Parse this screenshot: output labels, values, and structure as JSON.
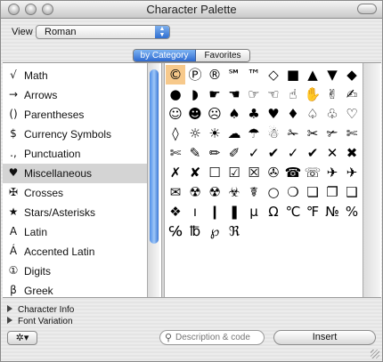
{
  "window": {
    "title": "Character Palette"
  },
  "view": {
    "label": "View :",
    "selected": "Roman"
  },
  "tabs": [
    {
      "label": "by Category",
      "selected": true
    },
    {
      "label": "Favorites",
      "selected": false
    }
  ],
  "categories": [
    {
      "icon": "√",
      "label": "Math"
    },
    {
      "icon": "→",
      "label": "Arrows"
    },
    {
      "icon": "()",
      "label": "Parentheses"
    },
    {
      "icon": "$",
      "label": "Currency Symbols"
    },
    {
      "icon": ".,",
      "label": "Punctuation"
    },
    {
      "icon": "♥",
      "label": "Miscellaneous",
      "selected": true
    },
    {
      "icon": "✠",
      "label": "Crosses"
    },
    {
      "icon": "★",
      "label": "Stars/Asterisks"
    },
    {
      "icon": "A",
      "label": "Latin"
    },
    {
      "icon": "Á",
      "label": "Accented Latin"
    },
    {
      "icon": "①",
      "label": "Digits"
    },
    {
      "icon": "β",
      "label": "Greek"
    }
  ],
  "characters": [
    [
      "©",
      "Ⓟ",
      "®",
      "℠",
      "™",
      "◇",
      "■",
      "▲",
      "▼",
      "◆"
    ],
    [
      "●",
      "◗",
      "☛",
      "☚",
      "☞",
      "☜",
      "☝",
      "✋",
      "✌",
      "✍"
    ],
    [
      "☺",
      "☻",
      "☹",
      "♠",
      "♣",
      "♥",
      "♦",
      "♤",
      "♧",
      "♡"
    ],
    [
      "◊",
      "☼",
      "☀",
      "☁",
      "☂",
      "☃",
      "✁",
      "✂",
      "✃",
      "✄"
    ],
    [
      "✄",
      "✎",
      "✏",
      "✐",
      "✓",
      "✔",
      "✓",
      "✔",
      "✕",
      "✖"
    ],
    [
      "✗",
      "✘",
      "☐",
      "☑",
      "☒",
      "✇",
      "☎",
      "☏",
      "✈",
      "✈"
    ],
    [
      "✉",
      "☢",
      "☢",
      "☣",
      "☤",
      "○",
      "❍",
      "❏",
      "❐",
      "❑"
    ],
    [
      "❖",
      "ı",
      "❙",
      "❚",
      "μ",
      "Ω",
      "℃",
      "℉",
      "№",
      "%"
    ],
    [
      "℅",
      "℔",
      "℘",
      "ℜ"
    ]
  ],
  "footer": {
    "character_info": "Character Info",
    "font_variation": "Font Variation",
    "gear_label": "✲▾",
    "search_placeholder": "Description & code",
    "insert_label": "Insert"
  }
}
